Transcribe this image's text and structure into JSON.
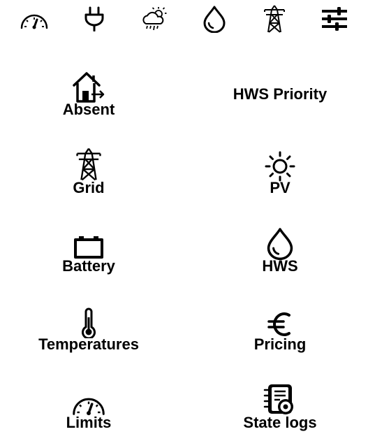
{
  "nav": [
    {
      "icon": "gauge-icon"
    },
    {
      "icon": "plug-icon"
    },
    {
      "icon": "weather-icon"
    },
    {
      "icon": "water-drop-icon"
    },
    {
      "icon": "pylon-icon"
    },
    {
      "icon": "sliders-icon"
    }
  ],
  "tiles": {
    "absent": {
      "label": "Absent",
      "icon": "home-exit-icon"
    },
    "hws_priority": {
      "label": "HWS Priority"
    },
    "grid": {
      "label": "Grid",
      "icon": "pylon-icon"
    },
    "pv": {
      "label": "PV",
      "icon": "sun-icon"
    },
    "battery": {
      "label": "Battery",
      "icon": "battery-icon"
    },
    "hws": {
      "label": "HWS",
      "icon": "water-drop-icon"
    },
    "temperatures": {
      "label": "Temperatures",
      "icon": "thermometer-icon"
    },
    "pricing": {
      "label": "Pricing",
      "icon": "euro-icon"
    },
    "limits": {
      "label": "Limits",
      "icon": "gauge-icon"
    },
    "state_logs": {
      "label": "State logs",
      "icon": "log-clock-icon"
    }
  }
}
